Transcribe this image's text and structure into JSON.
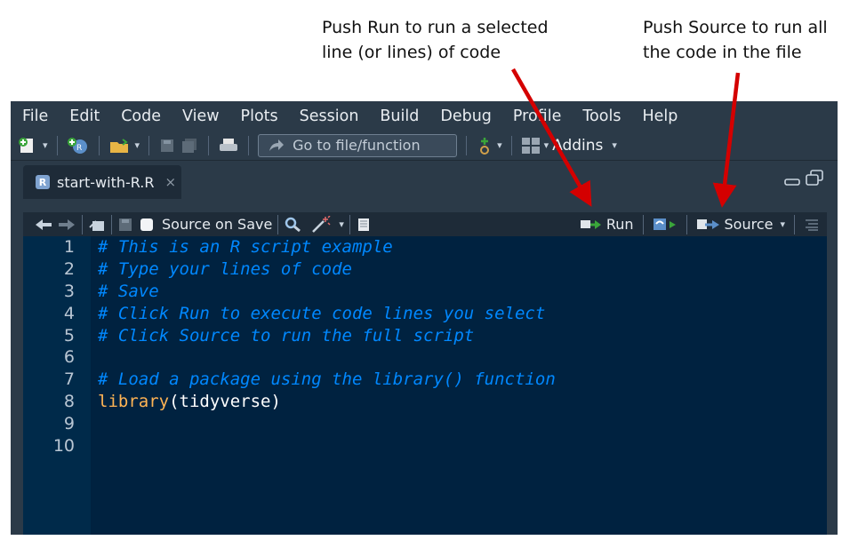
{
  "annotations": {
    "run": "Push Run to run a selected\nline (or lines) of code",
    "source": "Push Source to run all\nthe code in the file"
  },
  "menu": [
    "File",
    "Edit",
    "Code",
    "View",
    "Plots",
    "Session",
    "Build",
    "Debug",
    "Profile",
    "Tools",
    "Help"
  ],
  "toolbar": {
    "goto_placeholder": "Go to file/function",
    "addins_label": "Addins"
  },
  "tab": {
    "filename": "start-with-R.R",
    "close_glyph": "×"
  },
  "editor_toolbar": {
    "source_on_save": "Source on Save",
    "run_label": "Run",
    "source_label": "Source"
  },
  "code_lines": [
    {
      "n": "1",
      "text": "# This is an R script example",
      "kind": "comment"
    },
    {
      "n": "2",
      "text": "# Type your lines of code",
      "kind": "comment"
    },
    {
      "n": "3",
      "text": "# Save",
      "kind": "comment"
    },
    {
      "n": "4",
      "text": "# Click Run to execute code lines you select",
      "kind": "comment"
    },
    {
      "n": "5",
      "text": "# Click Source to run the full script",
      "kind": "comment"
    },
    {
      "n": "6",
      "text": "",
      "kind": "blank"
    },
    {
      "n": "7",
      "text": "# Load a package using the library() function",
      "kind": "comment"
    },
    {
      "n": "8",
      "func": "library",
      "args": "(tidyverse)",
      "kind": "call"
    },
    {
      "n": "9",
      "text": "",
      "kind": "blank"
    },
    {
      "n": "10",
      "text": "",
      "kind": "blank"
    }
  ],
  "colors": {
    "arrow": "#d40000",
    "editor_bg": "#002240",
    "chrome_bg": "#2b3a48",
    "comment": "#0088ff",
    "function": "#ffb454"
  }
}
